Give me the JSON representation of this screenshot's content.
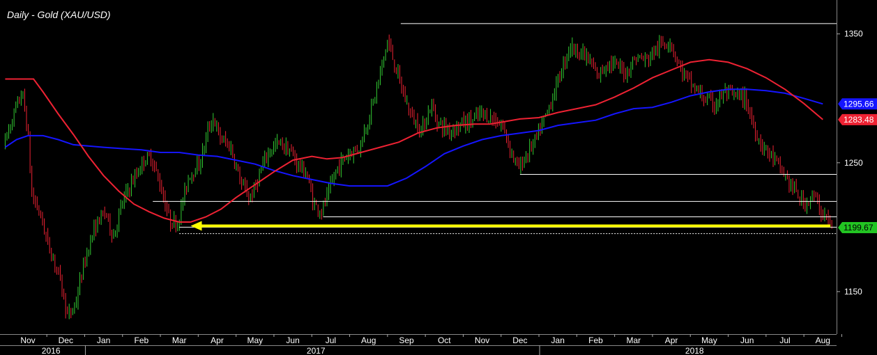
{
  "chart_data": {
    "type": "candlestick",
    "title": "Daily - Gold (XAU/USD)",
    "y_ticks": [
      1150,
      1250,
      1350
    ],
    "ylim": [
      1117,
      1372
    ],
    "x_months": [
      {
        "label": "Nov",
        "index": 0
      },
      {
        "label": "Dec",
        "index": 1
      },
      {
        "label": "Jan",
        "index": 2
      },
      {
        "label": "Feb",
        "index": 3
      },
      {
        "label": "Mar",
        "index": 4
      },
      {
        "label": "Apr",
        "index": 5
      },
      {
        "label": "May",
        "index": 6
      },
      {
        "label": "Jun",
        "index": 7
      },
      {
        "label": "Jul",
        "index": 8
      },
      {
        "label": "Aug",
        "index": 9
      },
      {
        "label": "Sep",
        "index": 10
      },
      {
        "label": "Oct",
        "index": 11
      },
      {
        "label": "Nov",
        "index": 12
      },
      {
        "label": "Dec",
        "index": 13
      },
      {
        "label": "Jan",
        "index": 14
      },
      {
        "label": "Feb",
        "index": 15
      },
      {
        "label": "Mar",
        "index": 16
      },
      {
        "label": "Apr",
        "index": 17
      },
      {
        "label": "May",
        "index": 18
      },
      {
        "label": "Jun",
        "index": 19
      },
      {
        "label": "Jul",
        "index": 20
      },
      {
        "label": "Aug",
        "index": 21
      }
    ],
    "years": [
      {
        "label": "2016",
        "month_index": 0.5
      },
      {
        "label": "2017",
        "month_index": 7.5
      },
      {
        "label": "2018",
        "month_index": 17.5
      }
    ],
    "year_boundaries": [
      2,
      14
    ],
    "price_path": [
      [
        -0.6,
        1263
      ],
      [
        -0.3,
        1290
      ],
      [
        -0.1,
        1305
      ],
      [
        0.05,
        1272
      ],
      [
        0.15,
        1225
      ],
      [
        0.35,
        1212
      ],
      [
        0.6,
        1185
      ],
      [
        0.85,
        1165
      ],
      [
        1.0,
        1145
      ],
      [
        1.1,
        1130
      ],
      [
        1.3,
        1140
      ],
      [
        1.5,
        1168
      ],
      [
        1.7,
        1190
      ],
      [
        1.9,
        1205
      ],
      [
        2.1,
        1212
      ],
      [
        2.3,
        1192
      ],
      [
        2.5,
        1215
      ],
      [
        2.7,
        1230
      ],
      [
        2.9,
        1240
      ],
      [
        3.1,
        1252
      ],
      [
        3.3,
        1255
      ],
      [
        3.55,
        1232
      ],
      [
        3.8,
        1205
      ],
      [
        4.0,
        1203
      ],
      [
        4.3,
        1240
      ],
      [
        4.6,
        1250
      ],
      [
        4.8,
        1275
      ],
      [
        4.95,
        1285
      ],
      [
        5.1,
        1270
      ],
      [
        5.4,
        1262
      ],
      [
        5.7,
        1232
      ],
      [
        5.9,
        1223
      ],
      [
        6.0,
        1227
      ],
      [
        6.3,
        1252
      ],
      [
        6.5,
        1262
      ],
      [
        6.7,
        1265
      ],
      [
        6.95,
        1260
      ],
      [
        7.2,
        1248
      ],
      [
        7.4,
        1242
      ],
      [
        7.6,
        1218
      ],
      [
        7.8,
        1212
      ],
      [
        8.0,
        1227
      ],
      [
        8.2,
        1245
      ],
      [
        8.5,
        1257
      ],
      [
        8.8,
        1262
      ],
      [
        9.0,
        1280
      ],
      [
        9.2,
        1300
      ],
      [
        9.4,
        1325
      ],
      [
        9.55,
        1345
      ],
      [
        9.8,
        1320
      ],
      [
        10.0,
        1300
      ],
      [
        10.2,
        1285
      ],
      [
        10.45,
        1275
      ],
      [
        10.7,
        1295
      ],
      [
        10.9,
        1280
      ],
      [
        11.2,
        1275
      ],
      [
        11.5,
        1280
      ],
      [
        11.8,
        1283
      ],
      [
        12.0,
        1288
      ],
      [
        12.3,
        1285
      ],
      [
        12.6,
        1278
      ],
      [
        12.8,
        1260
      ],
      [
        13.0,
        1245
      ],
      [
        13.2,
        1255
      ],
      [
        13.5,
        1270
      ],
      [
        13.8,
        1292
      ],
      [
        14.1,
        1318
      ],
      [
        14.35,
        1340
      ],
      [
        14.6,
        1337
      ],
      [
        14.85,
        1330
      ],
      [
        15.1,
        1317
      ],
      [
        15.35,
        1328
      ],
      [
        15.6,
        1325
      ],
      [
        15.85,
        1320
      ],
      [
        16.1,
        1332
      ],
      [
        16.4,
        1330
      ],
      [
        16.7,
        1340
      ],
      [
        17.0,
        1345
      ],
      [
        17.3,
        1322
      ],
      [
        17.6,
        1310
      ],
      [
        17.9,
        1300
      ],
      [
        18.2,
        1295
      ],
      [
        18.45,
        1305
      ],
      [
        18.7,
        1302
      ],
      [
        19.0,
        1300
      ],
      [
        19.2,
        1280
      ],
      [
        19.4,
        1265
      ],
      [
        19.7,
        1255
      ],
      [
        20.0,
        1242
      ],
      [
        20.3,
        1228
      ],
      [
        20.55,
        1218
      ],
      [
        20.8,
        1225
      ],
      [
        21.0,
        1212
      ],
      [
        21.15,
        1208
      ],
      [
        21.25,
        1199.67
      ]
    ],
    "moving_average_red": [
      [
        -0.6,
        1315
      ],
      [
        0.15,
        1315
      ],
      [
        0.4,
        1305
      ],
      [
        0.8,
        1288
      ],
      [
        1.2,
        1272
      ],
      [
        1.6,
        1255
      ],
      [
        2.0,
        1240
      ],
      [
        2.4,
        1228
      ],
      [
        2.8,
        1218
      ],
      [
        3.2,
        1212
      ],
      [
        3.6,
        1207
      ],
      [
        4.0,
        1204
      ],
      [
        4.3,
        1204
      ],
      [
        4.7,
        1208
      ],
      [
        5.1,
        1214
      ],
      [
        5.5,
        1223
      ],
      [
        6.0,
        1233
      ],
      [
        6.5,
        1243
      ],
      [
        7.0,
        1252
      ],
      [
        7.5,
        1255
      ],
      [
        7.9,
        1253
      ],
      [
        8.3,
        1254
      ],
      [
        8.8,
        1258
      ],
      [
        9.3,
        1262
      ],
      [
        9.8,
        1266
      ],
      [
        10.3,
        1273
      ],
      [
        10.8,
        1277
      ],
      [
        11.3,
        1279
      ],
      [
        11.8,
        1280
      ],
      [
        12.2,
        1280
      ],
      [
        12.6,
        1282
      ],
      [
        13.0,
        1284
      ],
      [
        13.5,
        1285
      ],
      [
        14.0,
        1289
      ],
      [
        14.5,
        1292
      ],
      [
        15.0,
        1295
      ],
      [
        15.5,
        1301
      ],
      [
        16.0,
        1308
      ],
      [
        16.5,
        1316
      ],
      [
        17.0,
        1322
      ],
      [
        17.5,
        1328
      ],
      [
        18.0,
        1330
      ],
      [
        18.5,
        1328
      ],
      [
        19.0,
        1323
      ],
      [
        19.5,
        1316
      ],
      [
        20.0,
        1307
      ],
      [
        20.5,
        1296
      ],
      [
        21.0,
        1283.48
      ]
    ],
    "moving_average_blue": [
      [
        -0.6,
        1262
      ],
      [
        -0.3,
        1268
      ],
      [
        0.0,
        1271
      ],
      [
        0.4,
        1271
      ],
      [
        0.8,
        1268
      ],
      [
        1.2,
        1264
      ],
      [
        1.6,
        1263
      ],
      [
        2.0,
        1262
      ],
      [
        2.5,
        1261
      ],
      [
        3.0,
        1260
      ],
      [
        3.5,
        1258
      ],
      [
        4.0,
        1258
      ],
      [
        4.5,
        1256
      ],
      [
        5.0,
        1255
      ],
      [
        5.5,
        1252
      ],
      [
        6.0,
        1249
      ],
      [
        6.5,
        1244
      ],
      [
        7.0,
        1240
      ],
      [
        7.5,
        1237
      ],
      [
        8.0,
        1234
      ],
      [
        8.5,
        1232
      ],
      [
        9.0,
        1232
      ],
      [
        9.5,
        1232
      ],
      [
        10.0,
        1238
      ],
      [
        10.5,
        1247
      ],
      [
        11.0,
        1257
      ],
      [
        11.5,
        1263
      ],
      [
        12.0,
        1268
      ],
      [
        12.5,
        1271
      ],
      [
        13.0,
        1273
      ],
      [
        13.5,
        1275
      ],
      [
        14.0,
        1279
      ],
      [
        14.5,
        1281
      ],
      [
        15.0,
        1283
      ],
      [
        15.5,
        1288
      ],
      [
        16.0,
        1292
      ],
      [
        16.5,
        1293
      ],
      [
        17.0,
        1297
      ],
      [
        17.5,
        1302
      ],
      [
        18.0,
        1305
      ],
      [
        18.5,
        1307
      ],
      [
        19.0,
        1307
      ],
      [
        19.5,
        1306
      ],
      [
        20.0,
        1304
      ],
      [
        20.5,
        1300
      ],
      [
        21.0,
        1295.66
      ]
    ],
    "horizontal_levels": [
      {
        "value": 1358,
        "from_index": 9.85,
        "color": "#ffffff"
      },
      {
        "value": 1241,
        "from_index": 13.0,
        "color": "#ffffff"
      },
      {
        "value": 1220,
        "from_index": 3.3,
        "color": "#ffffff"
      },
      {
        "value": 1208,
        "from_index": 7.8,
        "color": "#ffffff"
      },
      {
        "value": 1200,
        "from_index": 4.0,
        "color": "#ffffff"
      },
      {
        "value": 1195,
        "from_index": 4.0,
        "color": "#ffffff",
        "dashed": true
      }
    ],
    "arrow": {
      "value": 1201,
      "from_index": 21.2,
      "to_index": 4.3,
      "color": "#ffff00"
    },
    "last_values": [
      {
        "label": "1295.66",
        "value": 1295.66,
        "color": "#1515ff",
        "text_color": "#ffffff"
      },
      {
        "label": "1283.48",
        "value": 1283.48,
        "color": "#ee2233",
        "text_color": "#ffffff"
      },
      {
        "label": "1199.67",
        "value": 1199.67,
        "color": "#22c422",
        "text_color": "#000000"
      }
    ],
    "colors": {
      "up": "#33cc33",
      "down": "#ee2233",
      "background": "#000000",
      "grid": "#444444"
    }
  }
}
